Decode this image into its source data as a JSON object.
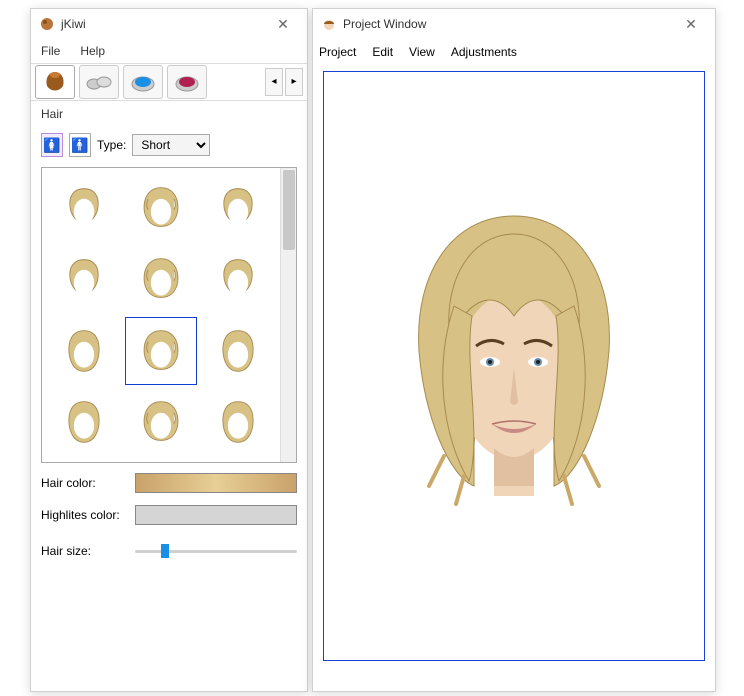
{
  "leftWindow": {
    "title": "jKiwi",
    "menus": [
      "File",
      "Help"
    ],
    "tabs": [
      "hair-tab",
      "accessories-tab",
      "eyeshadow-tab",
      "lipstick-tab"
    ],
    "section": "Hair",
    "typeLabel": "Type:",
    "typeValue": "Short",
    "hairItems": 12,
    "selectedHairIndex": 7,
    "hairColorLabel": "Hair color:",
    "highlitesLabel": "Highlites color:",
    "hairSizeLabel": "Hair size:",
    "sliderPercent": 16
  },
  "rightWindow": {
    "title": "Project Window",
    "menus": [
      "Project",
      "Edit",
      "View",
      "Adjustments"
    ]
  },
  "colors": {
    "selectionBlue": "#1040d0",
    "blonde": "#d8c184"
  }
}
